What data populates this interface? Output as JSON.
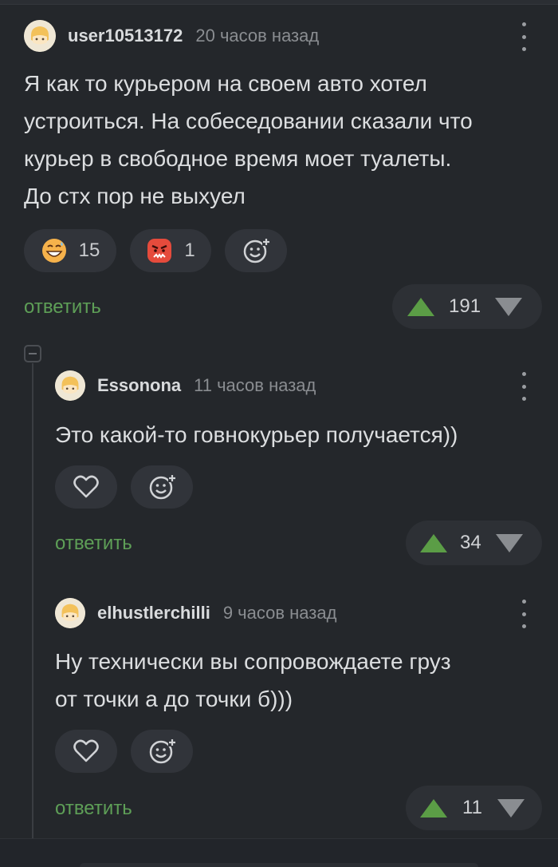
{
  "colors": {
    "background": "#24272b",
    "accent_green": "#5b9d46",
    "reply_green": "#5e9f57",
    "pill_bg": "#31343a"
  },
  "comments": [
    {
      "username": "user10513172",
      "time": "20 часов назад",
      "text_lines": [
        "Я как то курьером на своем авто хотел",
        "устроиться. На собеседовании сказали что",
        "курьер в свободное время моет туалеты.",
        "До стх пор не выхуел"
      ],
      "reactions": [
        {
          "icon": "grinning-sweat-emoji-icon",
          "count": "15"
        },
        {
          "icon": "angry-emoji-icon",
          "count": "1"
        }
      ],
      "add_reaction_icon": "add-emoji-icon",
      "reply_label": "ответить",
      "rating": "191"
    },
    {
      "username": "Essonona",
      "time": "11 часов назад",
      "text_lines": [
        "Это какой-то говнокурьер получается))"
      ],
      "like_icon": "heart-icon",
      "add_reaction_icon": "add-emoji-icon",
      "reply_label": "ответить",
      "rating": "34"
    },
    {
      "username": "elhustlerchilli",
      "time": "9 часов назад",
      "text_lines": [
        "Ну технически вы сопровождаете груз",
        "от точки а до точки б)))"
      ],
      "like_icon": "heart-icon",
      "add_reaction_icon": "add-emoji-icon",
      "reply_label": "ответить",
      "rating": "11"
    }
  ]
}
